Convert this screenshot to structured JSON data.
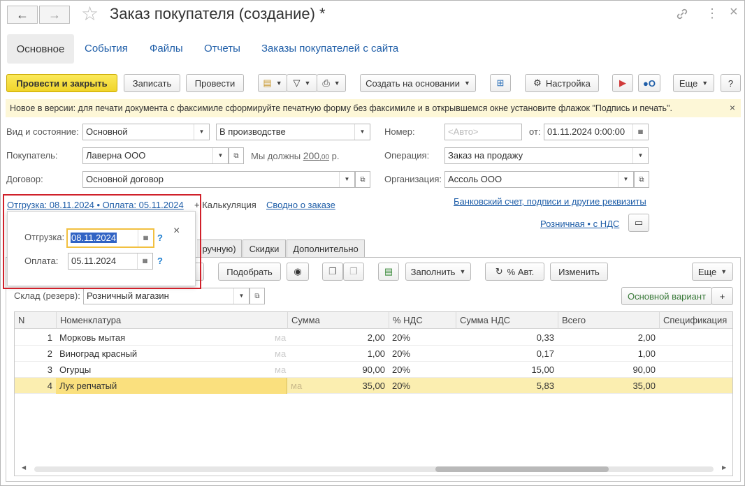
{
  "window": {
    "title": "Заказ покупателя (создание) *",
    "back_icon": "←",
    "forward_icon": "→",
    "star_icon": "☆",
    "link_icon": "🔗",
    "menu_icon": "⋮",
    "close_icon": "×"
  },
  "sections": {
    "active": "Основное",
    "links": [
      "События",
      "Файлы",
      "Отчеты",
      "Заказы покупателей с сайта"
    ]
  },
  "toolbar": {
    "post_and_close": "Провести и закрыть",
    "save": "Записать",
    "post": "Провести",
    "create_based_on": "Создать на основании",
    "settings": "Настройка",
    "more": "Еще",
    "help": "?"
  },
  "info_bar": {
    "text": "Новое в версии: для печати документа с факсимиле сформируйте печатную форму без факсимиле и в открывшемся окне установите флажок \"Подпись и печать\".",
    "close": "×"
  },
  "form": {
    "kind_label": "Вид и состояние:",
    "kind_value": "Основной",
    "state_value": "В производстве",
    "number_label": "Номер:",
    "number_placeholder": "<Авто>",
    "date_label": "от:",
    "date_value": "01.11.2024  0:00:00",
    "buyer_label": "Покупатель:",
    "buyer_value": "Лаверна ООО",
    "debt_prefix": "Мы должны",
    "debt_int": "200",
    "debt_frac": ",00",
    "debt_suffix": "р.",
    "operation_label": "Операция:",
    "operation_value": "Заказ на продажу",
    "contract_label": "Договор:",
    "contract_value": "Основной договор",
    "org_label": "Организация:",
    "org_value": "Ассоль ООО",
    "shipment_link": "Отгрузка: 08.11.2024 • Оплата: 05.11.2024",
    "calc_link": "+ Калькуляция",
    "summary_link": "Сводно о заказе",
    "bank_link": "Банковский счет, подписи и другие реквизиты",
    "retail_link": "Розничная • с НДС"
  },
  "popup": {
    "shipment_label": "Отгрузка:",
    "shipment_value": "08.11.2024",
    "payment_label": "Оплата:",
    "payment_value": "05.11.2024",
    "help": "?",
    "close": "×"
  },
  "tabs": {
    "partial": "ручную)",
    "discounts": "Скидки",
    "additional": "Дополнительно"
  },
  "table_toolbar": {
    "pick": "Подобрать",
    "fill": "Заполнить",
    "vat_auto": "% Авт.",
    "change": "Изменить",
    "more": "Еще"
  },
  "warehouse": {
    "label": "Склад (резерв):",
    "value": "Розничный магазин",
    "variant": "Основной вариант",
    "plus": "+"
  },
  "table": {
    "columns": [
      "N",
      "Номенклатура",
      "Сумма",
      "% НДС",
      "Сумма НДС",
      "Всего",
      "Спецификация"
    ],
    "hidden_fragment": "ма",
    "rows": [
      {
        "n": "1",
        "name": "Морковь мытая",
        "sum": "2,00",
        "vat_rate": "20%",
        "vat_sum": "0,33",
        "total": "2,00"
      },
      {
        "n": "2",
        "name": "Виноград красный",
        "sum": "1,00",
        "vat_rate": "20%",
        "vat_sum": "0,17",
        "total": "1,00"
      },
      {
        "n": "3",
        "name": "Огурцы",
        "sum": "90,00",
        "vat_rate": "20%",
        "vat_sum": "15,00",
        "total": "90,00"
      },
      {
        "n": "4",
        "name": "Лук репчатый",
        "sum": "35,00",
        "vat_rate": "20%",
        "vat_sum": "5,83",
        "total": "35,00"
      }
    ],
    "selected_row": 4
  },
  "colors": {
    "accent_yellow": "#f0d42a",
    "link_blue": "#1f5ea8",
    "highlight_red": "#d0202a",
    "selected_row": "#fbeeb0",
    "info_bg": "#fdf7d7"
  }
}
